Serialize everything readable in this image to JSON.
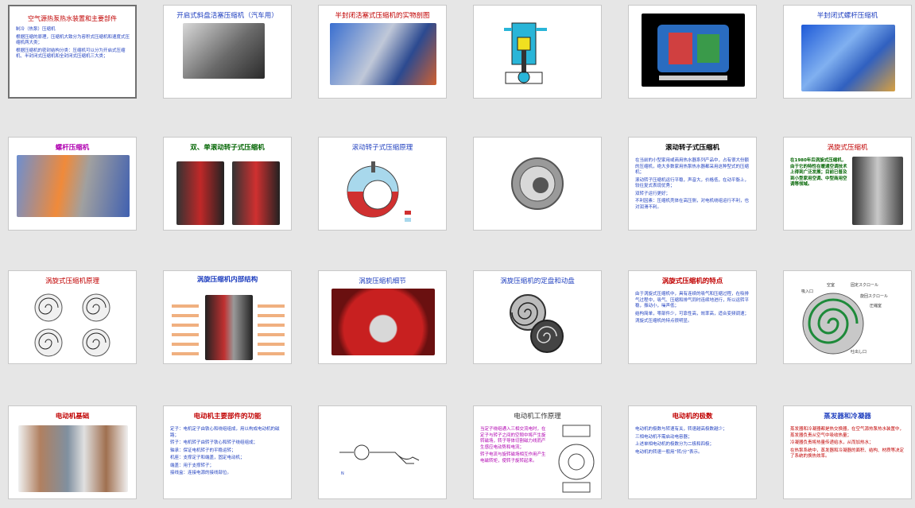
{
  "colors": {
    "blue_title": "#1f3fbf",
    "red_title": "#c00000",
    "green_title": "#006400",
    "magenta_title": "#b000b0"
  },
  "slides": [
    {
      "title": "空气源热泵热水装置和主要部件",
      "bullets": [
        "制冷（热泵）压缩机",
        "根据压缩的原理，压缩机大致分为容积式压缩机和速度式压缩机两大类；",
        "根据压缩机的密封结构分类：压缩机可以分为开启式压缩机、半封闭式压缩机和全封闭式压缩机三大类；"
      ]
    },
    {
      "title": "开启式斜盘活塞压缩机（汽车用）"
    },
    {
      "title": "半封闭活塞式压缩机的实物剖图"
    },
    {
      "title": ""
    },
    {
      "title": ""
    },
    {
      "title": "半封闭式螺杆压缩机"
    },
    {
      "title": "螺杆压缩机"
    },
    {
      "title": "双、单滚动转子式压缩机"
    },
    {
      "title": "滚动转子式压缩原理"
    },
    {
      "title": ""
    },
    {
      "title": "滚动转子式压缩机",
      "bullets": [
        "在当前的小型家用或商用热水器系列产品中，占有很大份额的压缩机，绝大多数家用热泵热水器都采用这种型式的压缩机；",
        "滚动转子压缩机运行平稳，声音大，价格低，在动平衡上，较往复式表现优秀；",
        "双转子运行更好；",
        "不利因素：压缩机壳体在高压侧，对电机绕组运行不利，也对润滑不利。"
      ]
    },
    {
      "title": "涡旋式压缩机",
      "bullets": [
        "在1980年后涡旋式压缩机，由于它的特性在暖通空调技术上得到广泛发展；目前已普及到小型家用空调、中型商用空调等领域。"
      ]
    },
    {
      "title": "涡旋式压缩机原理"
    },
    {
      "title": "涡旋压缩机内部结构"
    },
    {
      "title": "涡旋压缩机细节"
    },
    {
      "title": "涡旋压缩机的定盘和动盘"
    },
    {
      "title": "涡旋式压缩机的特点",
      "bullets": [
        "由于涡旋式压缩机中，具有连续的吸气和压缩过程，在吸排气过程中，吸气、压缩和排气同时连续地进行，所以运转平稳，振动小，噪声低；",
        "结构简单，零部件少，可靠性高，效率高，适合变频调速；",
        "涡旋式压缩机的特点很明显。"
      ]
    },
    {
      "title": "",
      "labels": [
        "吸入口",
        "空室",
        "固定スクロール",
        "旋回スクロール",
        "圧縮室",
        "吐出し口"
      ]
    },
    {
      "title": "电动机基础"
    },
    {
      "title": "电动机主要部件的功能",
      "bullets": [
        "定子：电机定子由铁心和绕组组成，用以构成电动机的磁路；",
        "转子：电机转子由转子铁心和转子绕组组成；",
        "轴承：保证电机转子的平稳运转；",
        "机座：支撑定子和端盖，固定电动机；",
        "端盖：用于支撑转子；",
        "接线盒：连接电源的接线部位。"
      ]
    },
    {
      "title": ""
    },
    {
      "title": "电动机工作原理",
      "bullets": [
        "当定子绕组通入三相交流电时，在定子与转子之间的空隙中将产生旋转磁场，转子导体切割磁力线而产生感应电动势和电流；",
        "转子电流与旋转磁场相互作用产生电磁转矩，使转子旋转起来。"
      ]
    },
    {
      "title": "电动机的极数",
      "bullets": [
        "电动机的极数与转速有关，转速越高极数越少；",
        "三相电动机不需启动电容器；",
        "上述单相电动机的极数分为二极和四极；",
        "电动机的转速一般用“转/分”表示。"
      ]
    },
    {
      "title": "蒸发器和冷凝器",
      "bullets": [
        "蒸发器和冷凝器都是热交换器，在空气源热泵热水装置中，蒸发器负责从空气中吸收热量；",
        "冷凝器负责将热量传递给水，从而加热水；",
        "在热泵系统中，蒸发器和冷凝器的面积、结构、材质等决定了系统的换热效率。"
      ]
    }
  ]
}
